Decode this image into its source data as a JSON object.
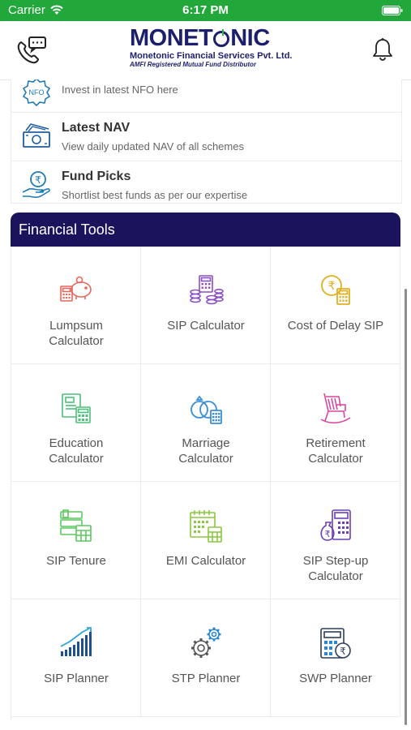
{
  "status_bar": {
    "carrier": "Carrier",
    "time": "6:17 PM"
  },
  "header": {
    "brand": {
      "part1": "MONET",
      "part2": "NIC"
    },
    "company": "Monetonic Financial Services Pvt. Ltd.",
    "tagline": "AMFI Registered Mutual Fund Distributor"
  },
  "menu": [
    {
      "title": "",
      "desc": "Invest in latest NFO here",
      "icon": "nfo-icon",
      "icon_text": "NFO"
    },
    {
      "title": "Latest NAV",
      "desc": "View daily updated NAV of all schemes",
      "icon": "currency-notes-icon"
    },
    {
      "title": "Fund Picks",
      "desc": "Shortlist best funds as per our expertise",
      "icon": "rupee-hand-icon"
    }
  ],
  "tools_section": {
    "title": "Financial Tools"
  },
  "tools": [
    {
      "label": "Lumpsum Calculator",
      "icon": "piggy-bank-calculator-icon"
    },
    {
      "label": "SIP Calculator",
      "icon": "coins-calculator-icon"
    },
    {
      "label": "Cost of Delay SIP",
      "icon": "rupee-coin-calculator-icon"
    },
    {
      "label": "Education Calculator",
      "icon": "book-calculator-icon"
    },
    {
      "label": "Marriage Calculator",
      "icon": "rings-calculator-icon"
    },
    {
      "label": "Retirement Calculator",
      "icon": "rocking-chair-icon"
    },
    {
      "label": "SIP Tenure",
      "icon": "books-calculator-icon"
    },
    {
      "label": "EMI Calculator",
      "icon": "calendar-calculator-icon"
    },
    {
      "label": "SIP Step-up Calculator",
      "icon": "money-bag-calculator-icon"
    },
    {
      "label": "SIP Planner",
      "icon": "growth-bars-icon"
    },
    {
      "label": "STP Planner",
      "icon": "gears-icon"
    },
    {
      "label": "SWP Planner",
      "icon": "calculator-rupee-icon"
    }
  ],
  "colors": {
    "status_green": "#22a83a",
    "brand_navy": "#1c1f6b",
    "tools_header": "#1a145c"
  }
}
